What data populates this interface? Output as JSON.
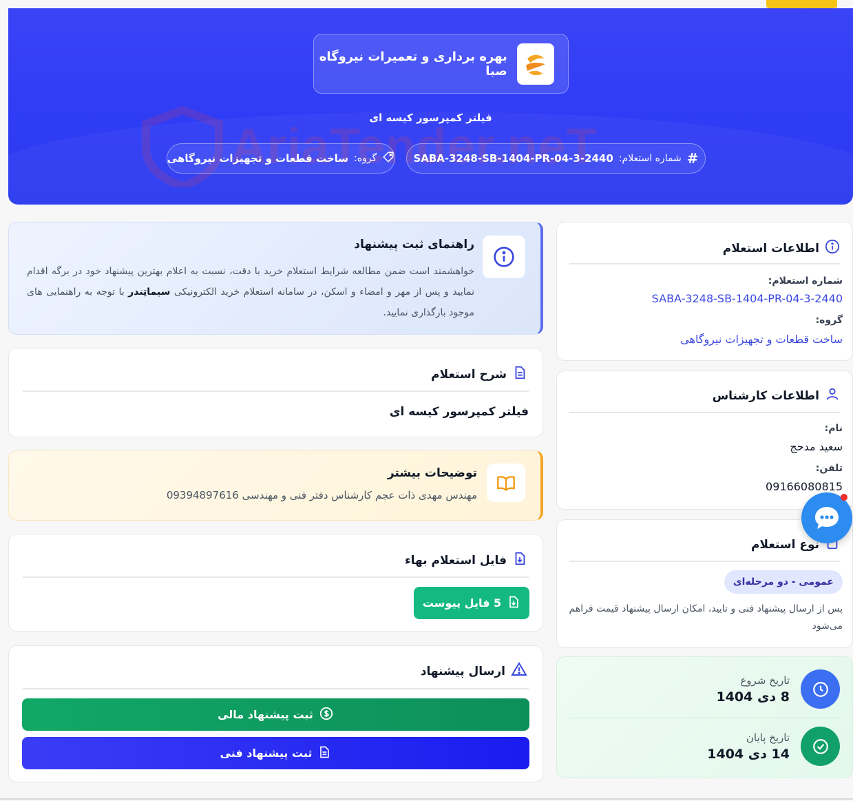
{
  "header": {
    "company_name": "بهره برداری و تعمیرات نیروگاه صبا",
    "subtitle": "فیلتر کمپرسور کیسه ای",
    "number_label": "شماره استعلام:",
    "number_value": "SABA-3248-SB-1404-PR-04-3-2440",
    "group_label": "گروه:",
    "group_value": "ساخت قطعات و تجهیزات نیروگاهی",
    "watermark": "AriaTender.neT"
  },
  "inquiry_info": {
    "title": "اطلاعات استعلام",
    "number_label": "شماره استعلام:",
    "number_value": "SABA-3248-SB-1404-PR-04-3-2440",
    "group_label": "گروه:",
    "group_value": "ساخت قطعات و تجهیزات نیروگاهی"
  },
  "expert_info": {
    "title": "اطلاعات کارشناس",
    "name_label": "نام:",
    "name_value": "سعید مدحج",
    "phone_label": "تلفن:",
    "phone_value": "09166080815"
  },
  "inquiry_type": {
    "title": "نوع استعلام",
    "badge": "عمومی - دو مرحله‌ای",
    "description": "پس از ارسال پیشنهاد فنی و تایید، امکان ارسال پیشنهاد قیمت فراهم می‌شود"
  },
  "dates": {
    "start_label": "تاریخ شروع",
    "start_value": "8 دی 1404",
    "end_label": "تاریخ پایان",
    "end_value": "14 دی 1404"
  },
  "guide": {
    "title": "راهنمای ثبت پیشنهاد",
    "text_before": "خواهشمند است ضمن مطالعه شرایط استعلام خرید با دقت، نسبت به اعلام بهترین پیشنهاد خود در برگه اقدام نمایید و پس از مهر و امضاء و اسکن، در سامانه استعلام خرید الکترونیکی ",
    "text_bold": "سیماتِندر",
    "text_after": " با توجه به راهنمایی های موجود بارگذاری نمایید."
  },
  "description_card": {
    "title": "شرح استعلام",
    "body": "فیلتر کمپرسور کیسه ای"
  },
  "more_info": {
    "title": "توضیحات بیشتر",
    "body": "مهندس مهدی ذات عجم کارشناس دفتر فنی و مهندسی 09394897616"
  },
  "price_file": {
    "title": "فایل استعلام بهاء",
    "button": "5 فایل پیوست"
  },
  "submit": {
    "title": "ارسال پیشنهاد",
    "financial_button": "ثبت پیشنهاد مالی",
    "technical_button": "ثبت پیشنهاد فنی"
  },
  "colors": {
    "hero_blue": "#2f3cf5",
    "accent_yellow": "#f5c518",
    "green": "#14b982",
    "link_blue": "#3b47e0"
  }
}
